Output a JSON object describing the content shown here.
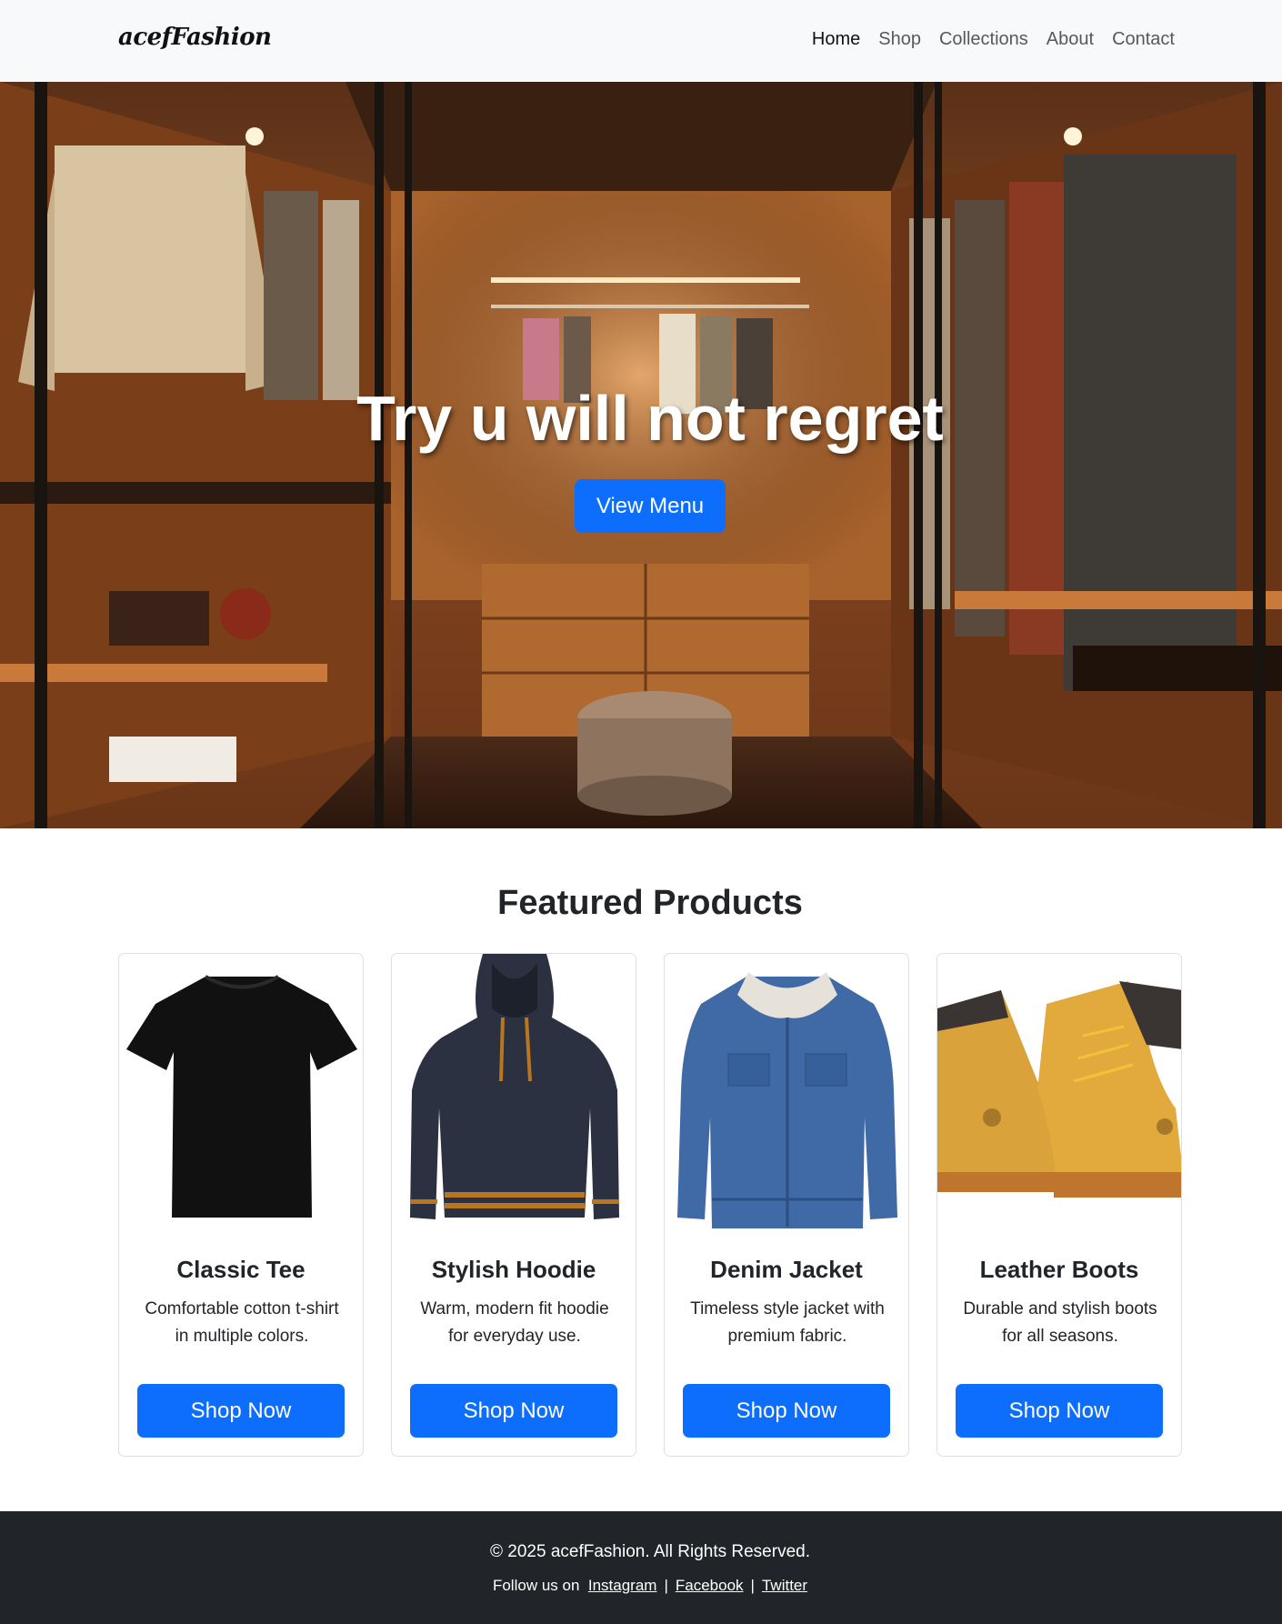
{
  "header": {
    "brand": "acefFashion",
    "nav": [
      {
        "label": "Home",
        "active": true
      },
      {
        "label": "Shop",
        "active": false
      },
      {
        "label": "Collections",
        "active": false
      },
      {
        "label": "About",
        "active": false
      },
      {
        "label": "Contact",
        "active": false
      }
    ]
  },
  "hero": {
    "title": "Try u will not regret",
    "button_label": "View Menu",
    "image_subject": "walk-in wardrobe with wooden shelves and hanging clothes"
  },
  "featured": {
    "title": "Featured Products",
    "products": [
      {
        "name": "Classic Tee",
        "description": "Comfortable cotton t-shirt in multiple colors.",
        "button_label": "Shop Now",
        "image_icon": "t-shirt-image"
      },
      {
        "name": "Stylish Hoodie",
        "description": "Warm, modern fit hoodie for everyday use.",
        "button_label": "Shop Now",
        "image_icon": "hoodie-image"
      },
      {
        "name": "Denim Jacket",
        "description": "Timeless style jacket with premium fabric.",
        "button_label": "Shop Now",
        "image_icon": "jacket-image"
      },
      {
        "name": "Leather Boots",
        "description": "Durable and stylish boots for all seasons.",
        "button_label": "Shop Now",
        "image_icon": "boots-image"
      }
    ]
  },
  "footer": {
    "copyright": "© 2025 acefFashion. All Rights Reserved.",
    "follow_label": "Follow us on",
    "links": [
      "Instagram",
      "Facebook",
      "Twitter"
    ]
  },
  "colors": {
    "primary": "#0d6efd",
    "navbar_bg": "#f8f9fa",
    "footer_bg": "#212529",
    "text": "#212529"
  }
}
